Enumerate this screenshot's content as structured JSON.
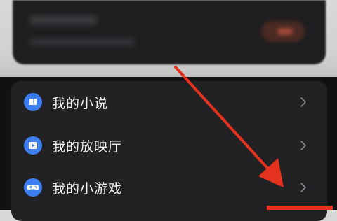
{
  "menu": {
    "items": [
      {
        "label": "我的小说",
        "icon": "book-icon"
      },
      {
        "label": "我的放映厅",
        "icon": "play-icon"
      },
      {
        "label": "我的小游戏",
        "icon": "gamepad-icon"
      }
    ]
  },
  "colors": {
    "icon_blue": "#3d7ff3",
    "card_bg": "#222225",
    "arrow_red": "#e5321f"
  }
}
